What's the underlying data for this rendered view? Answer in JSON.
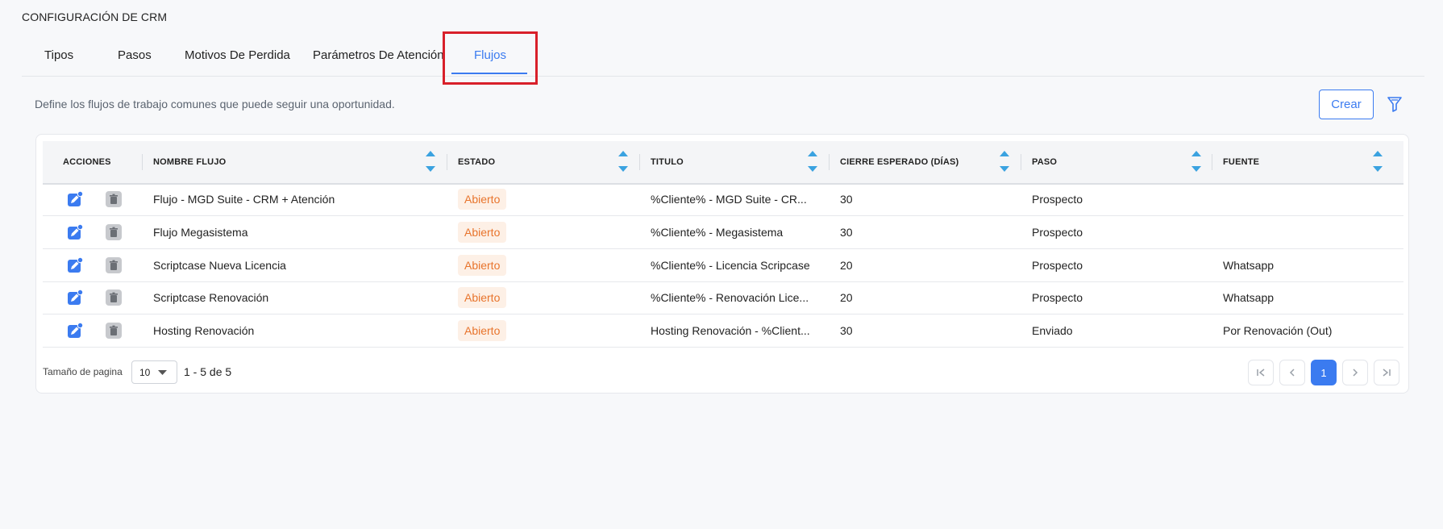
{
  "page": {
    "title": "CONFIGURACIÓN DE CRM"
  },
  "tabs": [
    {
      "label": "Tipos"
    },
    {
      "label": "Pasos"
    },
    {
      "label": "Motivos De Perdida"
    },
    {
      "label": "Parámetros De Atención"
    },
    {
      "label": "Flujos",
      "active": true
    }
  ],
  "description": "Define los flujos de trabajo comunes que puede seguir una oportunidad.",
  "toolbar": {
    "create_label": "Crear",
    "filter_icon": "filter-icon"
  },
  "table": {
    "columns": [
      "ACCIONES",
      "NOMBRE FLUJO",
      "ESTADO",
      "TITULO",
      "CIERRE ESPERADO (DÍAS)",
      "PASO",
      "FUENTE"
    ],
    "rows": [
      {
        "nombre": "Flujo - MGD Suite - CRM + Atención",
        "estado": "Abierto",
        "titulo": "%Cliente% - MGD Suite - CR...",
        "cierre": "30",
        "paso": "Prospecto",
        "fuente": ""
      },
      {
        "nombre": "Flujo Megasistema",
        "estado": "Abierto",
        "titulo": "%Cliente% - Megasistema",
        "cierre": "30",
        "paso": "Prospecto",
        "fuente": ""
      },
      {
        "nombre": "Scriptcase Nueva Licencia",
        "estado": "Abierto",
        "titulo": "%Cliente% - Licencia Scripcase",
        "cierre": "20",
        "paso": "Prospecto",
        "fuente": "Whatsapp"
      },
      {
        "nombre": "Scriptcase Renovación",
        "estado": "Abierto",
        "titulo": "%Cliente% - Renovación Lice...",
        "cierre": "20",
        "paso": "Prospecto",
        "fuente": "Whatsapp"
      },
      {
        "nombre": "Hosting Renovación",
        "estado": "Abierto",
        "titulo": "Hosting Renovación - %Client...",
        "cierre": "30",
        "paso": "Enviado",
        "fuente": "Por Renovación (Out)"
      }
    ]
  },
  "pagination": {
    "page_size_label": "Tamaño de pagina",
    "page_size": "10",
    "range": "1 - 5 de 5",
    "current_page": "1"
  },
  "colors": {
    "accent": "#3b7bf0",
    "status_badge": "#e8742c",
    "highlight": "#d8202a"
  }
}
